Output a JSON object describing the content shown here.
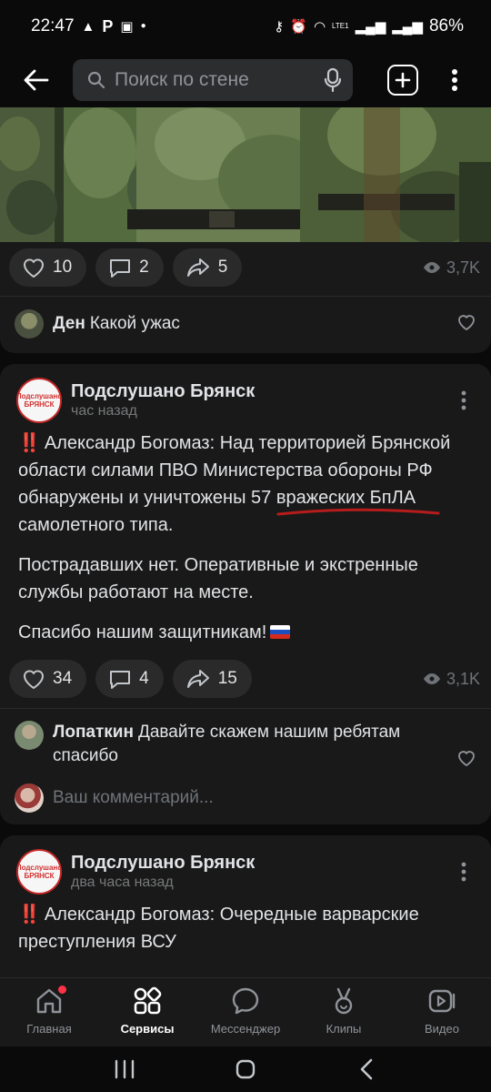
{
  "status_bar": {
    "time": "22:47",
    "battery": "86%",
    "network": "LTE1"
  },
  "search": {
    "placeholder": "Поиск по стене"
  },
  "post1": {
    "likes": "10",
    "comments": "2",
    "shares": "5",
    "views": "3,7K",
    "comment": {
      "author": "Ден",
      "text": "Какой ужас"
    }
  },
  "post2": {
    "group": "Подслушано Брянск",
    "time": "час назад",
    "avatar_text_top": "Подслушано",
    "avatar_text_bottom": "БРЯНСК",
    "bang": "‼️",
    "paragraph1": "Александр Богомаз: Над территорией Брянской области силами ПВО Министерства обороны РФ обнаружены и уничтожены 57 вражеских БпЛА самолетного типа.",
    "paragraph2": "Пострадавших нет. Оперативные и экстренные службы работают на месте.",
    "paragraph3": "Спасибо нашим защитникам!",
    "likes": "34",
    "comments": "4",
    "shares": "15",
    "views": "3,1K",
    "comment": {
      "author": "Лопаткин",
      "text": "Давайте скажем нашим ребятам спасибо"
    },
    "comment_placeholder": "Ваш комментарий..."
  },
  "post3": {
    "group": "Подслушано Брянск",
    "time": "два часа назад",
    "avatar_text_top": "Подслушано",
    "avatar_text_bottom": "БРЯНСК",
    "bang": "‼️",
    "paragraph1": "Александр Богомаз: Очередные варварские преступления ВСУ"
  },
  "bottom_nav": [
    {
      "label": "Главная",
      "icon": "home-icon"
    },
    {
      "label": "Сервисы",
      "icon": "services-icon"
    },
    {
      "label": "Мессенджер",
      "icon": "messenger-icon"
    },
    {
      "label": "Клипы",
      "icon": "clips-icon"
    },
    {
      "label": "Видео",
      "icon": "video-icon"
    }
  ],
  "colors": {
    "background": "#0a0a0a",
    "card": "#191919",
    "accent_red": "#e53935",
    "muted": "#76787a"
  }
}
